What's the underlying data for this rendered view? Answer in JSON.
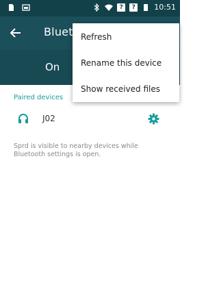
{
  "status_bar": {
    "left_icons": [
      "sim-card-icon",
      "image-icon"
    ],
    "right_icons": [
      "bluetooth-icon",
      "wifi-icon",
      "signal-icon",
      "battery-icon"
    ],
    "sim1_glyph": "?",
    "sim2_glyph": "?",
    "time": "10:51"
  },
  "toolbar": {
    "back_icon": "back-arrow-icon",
    "title": "Bluet"
  },
  "switch_bar": {
    "label": "On"
  },
  "paired_section": {
    "header": "Paired devices",
    "devices": [
      {
        "name": "J02",
        "icon": "headset-icon",
        "settings_icon": "gear-icon"
      }
    ]
  },
  "visibility_message": "Sprd is visible to nearby devices while Bluetooth settings is open.",
  "overflow_menu": {
    "items": [
      "Refresh",
      "Rename this device",
      "Show received files"
    ]
  },
  "colors": {
    "status_bar": "#12414a",
    "toolbar": "#1b4f59",
    "switch_bar": "#184a54",
    "accent": "#1a9b9c"
  }
}
